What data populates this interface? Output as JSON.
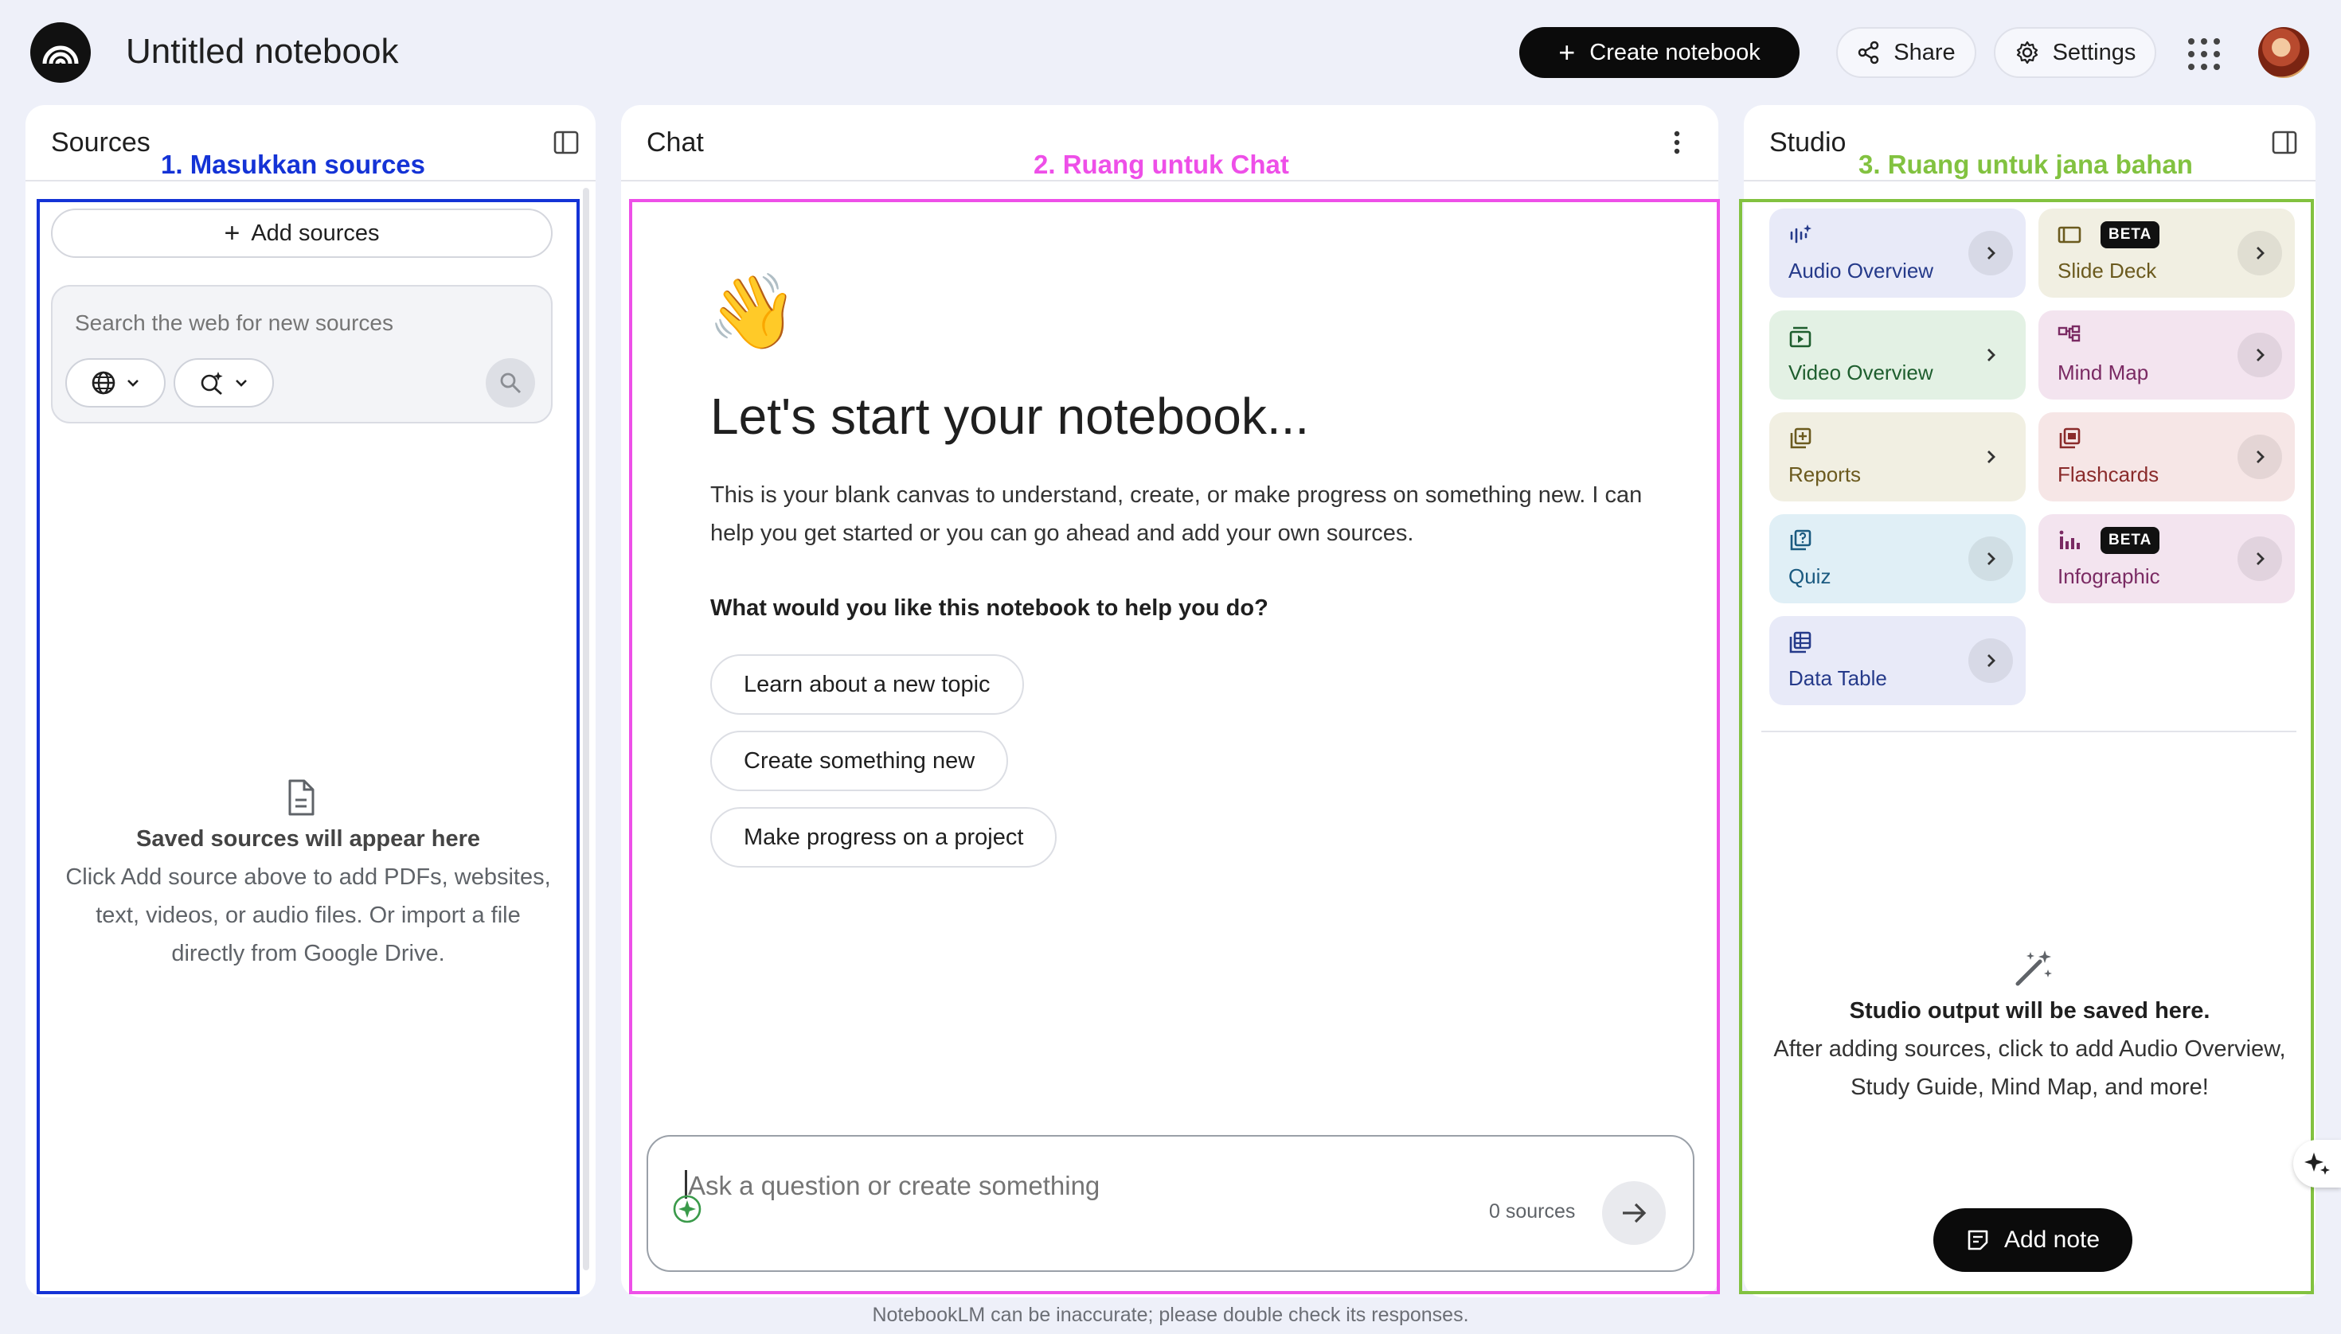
{
  "header": {
    "title": "Untitled notebook",
    "create_label": "Create notebook",
    "share_label": "Share",
    "settings_label": "Settings"
  },
  "sources": {
    "heading": "Sources",
    "annotation": "1. Masukkan sources",
    "add_label": "Add sources",
    "search_placeholder": "Search the web for new sources",
    "empty_title": "Saved sources will appear here",
    "empty_line1": "Click Add source above to add PDFs, websites,",
    "empty_line2": "text, videos, or audio files. Or import a file",
    "empty_line3": "directly from Google Drive."
  },
  "chat": {
    "heading": "Chat",
    "annotation": "2. Ruang untuk Chat",
    "emoji": "👋",
    "headline": "Let's start your notebook...",
    "intro_line1": "This is your blank canvas to understand, create, or make progress on something new. I can",
    "intro_line2": "help you get started or you can go ahead and add your own sources.",
    "question": "What would you like this notebook to help you do?",
    "suggestions": [
      "Learn about a new topic",
      "Create something new",
      "Make progress on a project"
    ],
    "input_placeholder": "Ask a question or create something",
    "source_count": "0 sources"
  },
  "studio": {
    "heading": "Studio",
    "annotation": "3. Ruang untuk jana bahan",
    "beta_label": "BETA",
    "tiles": [
      {
        "label": "Audio Overview",
        "icon": "audio-wave-icon",
        "color": "#253a8a"
      },
      {
        "label": "Slide Deck",
        "icon": "slides-icon",
        "color": "#6b5a1e"
      },
      {
        "label": "Video Overview",
        "icon": "video-icon",
        "color": "#1e5e2e"
      },
      {
        "label": "Mind Map",
        "icon": "mind-map-icon",
        "color": "#7a2a63"
      },
      {
        "label": "Reports",
        "icon": "reports-icon",
        "color": "#6b5a1e"
      },
      {
        "label": "Flashcards",
        "icon": "flashcards-icon",
        "color": "#8a2b2b"
      },
      {
        "label": "Quiz",
        "icon": "quiz-icon",
        "color": "#1a5a80"
      },
      {
        "label": "Infographic",
        "icon": "infographic-icon",
        "color": "#7a2a63"
      },
      {
        "label": "Data Table",
        "icon": "table-icon",
        "color": "#253a8a"
      }
    ],
    "empty_title": "Studio output will be saved here.",
    "empty_line1": "After adding sources, click to add Audio Overview,",
    "empty_line2": "Study Guide, Mind Map, and more!",
    "add_note_label": "Add note"
  },
  "footer": {
    "disclaimer": "NotebookLM can be inaccurate; please double check its responses."
  },
  "colors": {
    "page_bg": "#eef0f9",
    "annotation_blue": "#1433d6",
    "annotation_pink": "#ee4fe8",
    "annotation_green": "#82c240"
  }
}
